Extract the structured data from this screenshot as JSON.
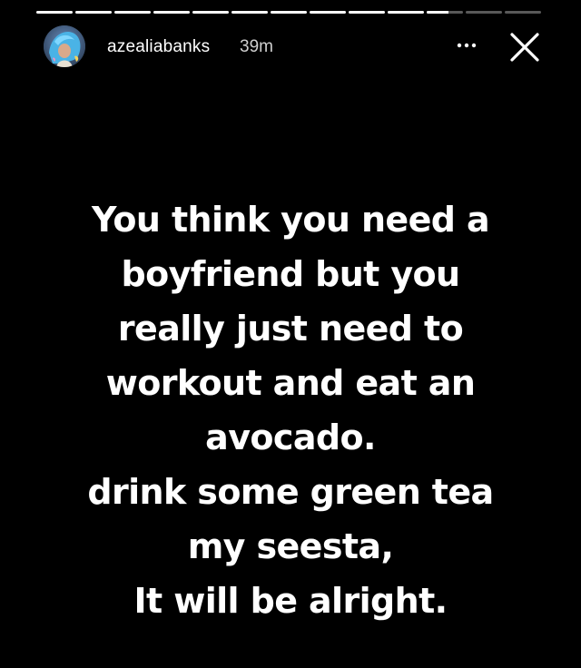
{
  "story": {
    "progress_segments": [
      1,
      1,
      1,
      1,
      1,
      1,
      1,
      1,
      1,
      1,
      0.6,
      0,
      0
    ],
    "accent_color": "#ffffff",
    "background_color": "#000000"
  },
  "header": {
    "username": "azealiabanks",
    "time_ago": "39m",
    "more_icon": "more-horizontal-icon",
    "close_icon": "close-icon"
  },
  "caption": {
    "lines": [
      "You think you need a",
      "boyfriend but you",
      "really just need to",
      "workout and eat an",
      "avocado.",
      "drink some green tea",
      "my seesta,",
      "It will be alright."
    ]
  }
}
